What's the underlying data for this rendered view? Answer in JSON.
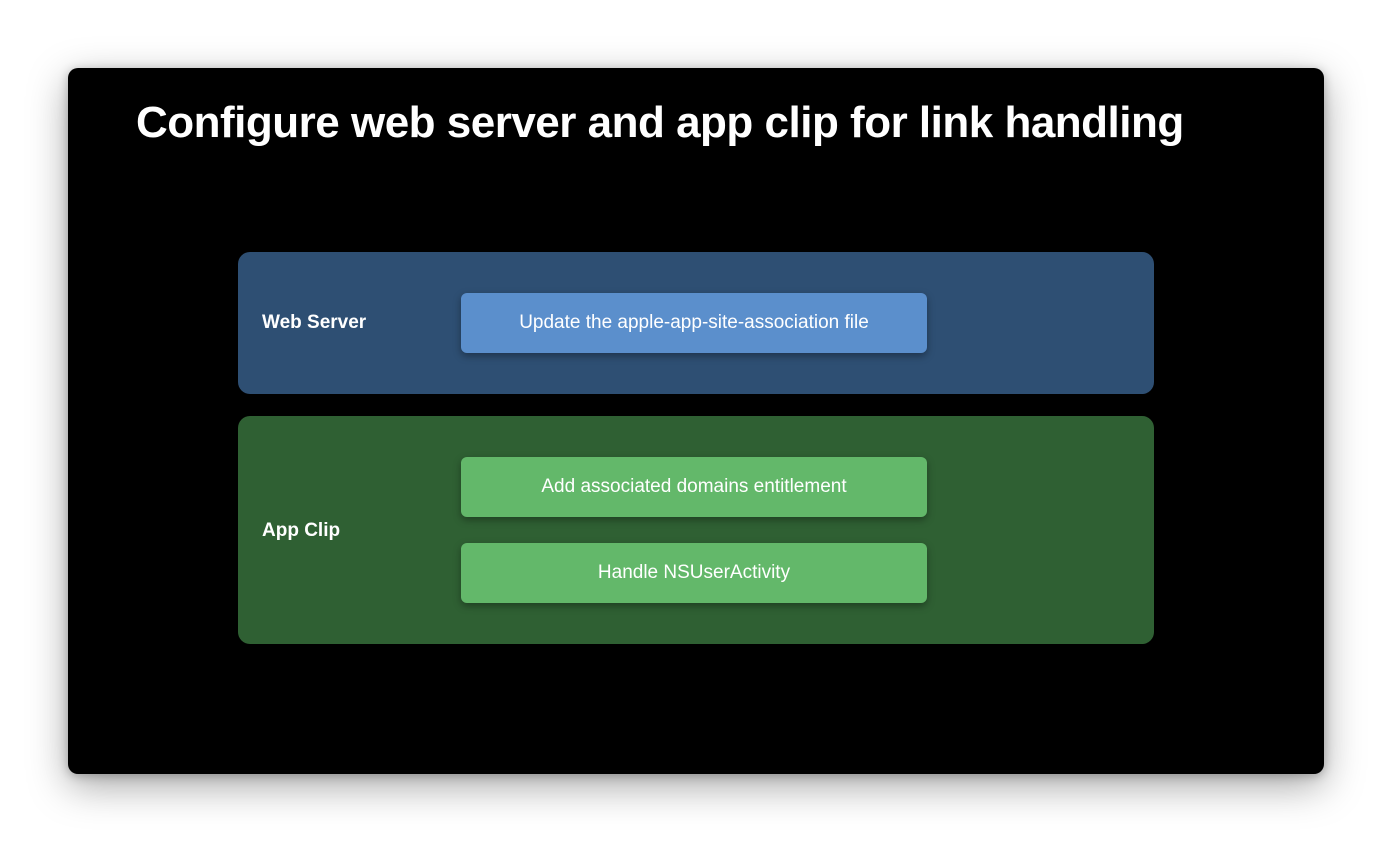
{
  "slide": {
    "title": "Configure web server and app clip for link handling"
  },
  "colors": {
    "background": "#000000",
    "web_panel": "#2e4f73",
    "web_step": "#5b8fcc",
    "clip_panel": "#2f6033",
    "clip_step": "#63b86a"
  },
  "sections": {
    "web_server": {
      "label": "Web Server",
      "steps": [
        "Update the apple-app-site-association file"
      ]
    },
    "app_clip": {
      "label": "App Clip",
      "steps": [
        "Add associated domains entitlement",
        "Handle NSUserActivity"
      ]
    }
  }
}
